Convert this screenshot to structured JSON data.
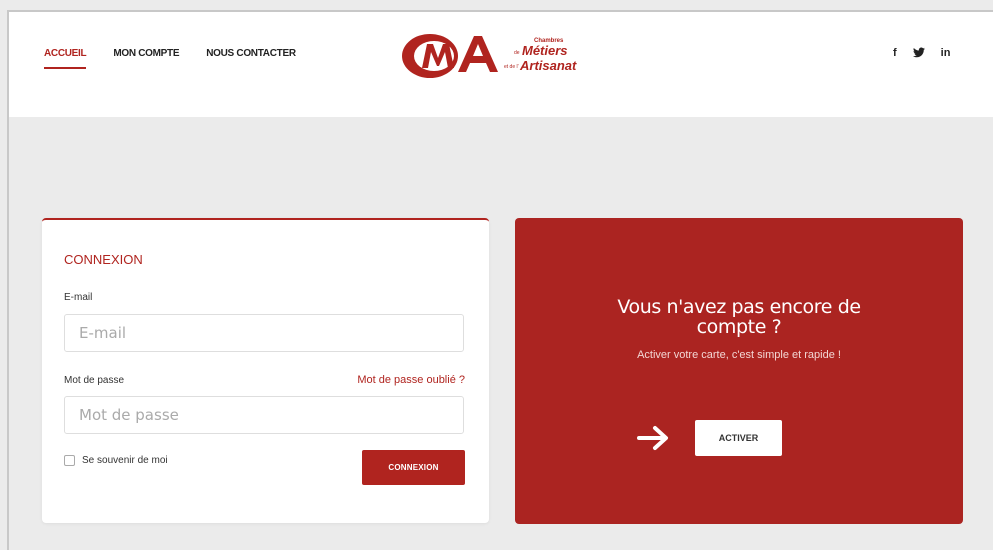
{
  "nav": {
    "items": [
      {
        "label": "ACCUEIL",
        "active": true
      },
      {
        "label": "MON COMPTE",
        "active": false
      },
      {
        "label": "NOUS CONTACTER",
        "active": false
      }
    ]
  },
  "logo": {
    "mark": "CMA",
    "line1": "Chambres",
    "line2_small": "de",
    "line2": "Métiers",
    "line3_small": "et de l'",
    "line3": "Artisanat"
  },
  "social": {
    "facebook": "f",
    "twitter": "🐦",
    "linkedin": "in",
    "icons": [
      "facebook-icon",
      "twitter-icon",
      "linkedin-icon"
    ]
  },
  "login": {
    "title": "CONNEXION",
    "email_label": "E-mail",
    "email_placeholder": "E-mail",
    "email_value": "",
    "password_label": "Mot de passe",
    "password_placeholder": "Mot de passe",
    "password_value": "",
    "forgot_link": "Mot de passe oublié ?",
    "remember_label": "Se souvenir de moi",
    "remember_checked": false,
    "submit_label": "CONNEXION"
  },
  "promo": {
    "title": "Vous n'avez pas encore de compte ?",
    "subtitle": "Activer votre carte, c'est simple et rapide !",
    "button_label": "ACTIVER",
    "arrow_icon": "arrow-right-icon"
  },
  "colors": {
    "brand": "#b0241f",
    "promo_bg": "#ab2421",
    "page_bg": "#ebebeb"
  }
}
